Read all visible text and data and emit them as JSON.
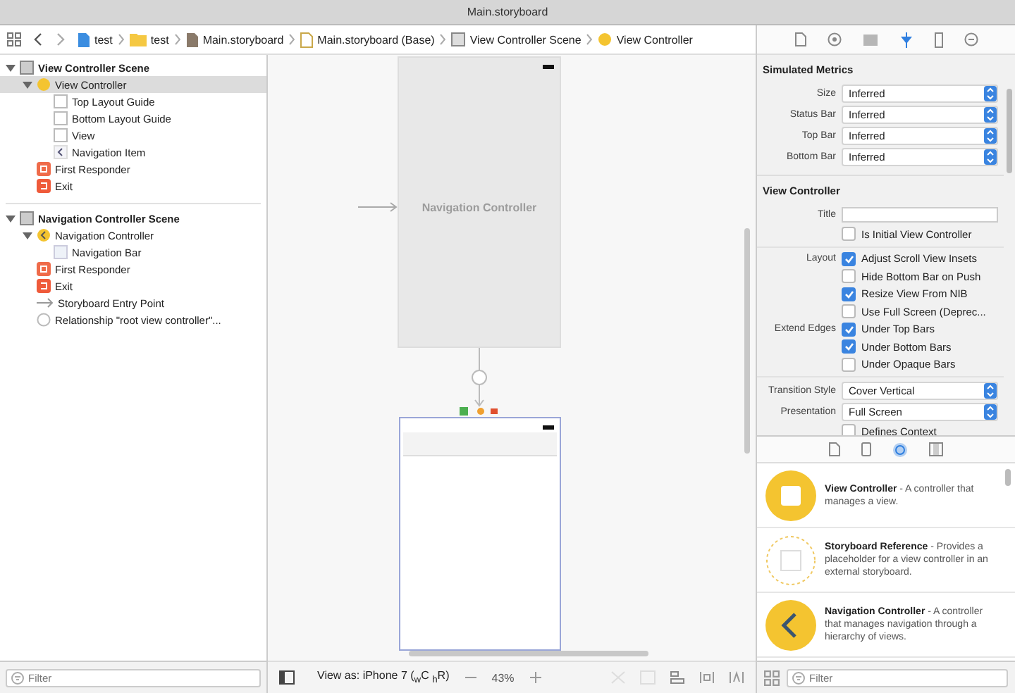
{
  "window": {
    "title": "Main.storyboard"
  },
  "breadcrumbs": [
    {
      "label": "test",
      "kind": "project"
    },
    {
      "label": "test",
      "kind": "folder"
    },
    {
      "label": "Main.storyboard",
      "kind": "storyboard"
    },
    {
      "label": "Main.storyboard (Base)",
      "kind": "localized"
    },
    {
      "label": "View Controller Scene",
      "kind": "scene"
    },
    {
      "label": "View Controller",
      "kind": "controller"
    }
  ],
  "outline": {
    "items": [
      {
        "label": "View Controller Scene",
        "kind": "scene",
        "expanded": true,
        "selected": false,
        "children": [
          {
            "label": "View Controller",
            "kind": "controller",
            "expanded": true,
            "selected": true,
            "children": [
              {
                "label": "Top Layout Guide",
                "kind": "guide",
                "selected": false
              },
              {
                "label": "Bottom Layout Guide",
                "kind": "guide",
                "selected": false
              },
              {
                "label": "View",
                "kind": "view",
                "selected": false
              },
              {
                "label": "Navigation Item",
                "kind": "navitem",
                "selected": false
              }
            ]
          },
          {
            "label": "First Responder",
            "kind": "responder",
            "selected": false
          },
          {
            "label": "Exit",
            "kind": "exit",
            "selected": false
          }
        ]
      },
      {
        "label": "Navigation Controller Scene",
        "kind": "scene",
        "expanded": true,
        "selected": false,
        "children": [
          {
            "label": "Navigation Controller",
            "kind": "navcontroller",
            "expanded": true,
            "selected": false,
            "children": [
              {
                "label": "Navigation Bar",
                "kind": "navbar",
                "selected": false
              }
            ]
          },
          {
            "label": "First Responder",
            "kind": "responder",
            "selected": false
          },
          {
            "label": "Exit",
            "kind": "exit",
            "selected": false
          },
          {
            "label": "Storyboard Entry Point",
            "kind": "entry",
            "selected": false
          },
          {
            "label": "Relationship \"root view controller\"...",
            "kind": "relationship",
            "selected": false
          }
        ]
      }
    ],
    "filter": {
      "placeholder": "Filter"
    }
  },
  "canvas": {
    "scene_title": "Navigation Controller",
    "view_as": "View as: iPhone 7 ($_{w}$C $_{h}$R)",
    "zoom": "43%"
  },
  "inspector": {
    "tabs": [
      {
        "kind": "file",
        "selected": false
      },
      {
        "kind": "help",
        "selected": false
      },
      {
        "kind": "identity",
        "selected": false
      },
      {
        "kind": "attributes",
        "selected": true
      },
      {
        "kind": "size",
        "selected": false
      },
      {
        "kind": "connections",
        "selected": false
      }
    ],
    "simulated_metrics": {
      "title": "Simulated Metrics",
      "fields": [
        {
          "label": "Size",
          "value": "Inferred"
        },
        {
          "label": "Status Bar",
          "value": "Inferred"
        },
        {
          "label": "Top Bar",
          "value": "Inferred"
        },
        {
          "label": "Bottom Bar",
          "value": "Inferred"
        }
      ]
    },
    "view_controller": {
      "title": "View Controller",
      "title_label": "Title",
      "rows": [
        {
          "kind": "checkbox",
          "text": "Is Initial View Controller",
          "checked": false
        },
        {
          "kind": "checkbox",
          "label": "Layout",
          "text": "Adjust Scroll View Insets",
          "checked": true
        },
        {
          "kind": "checkbox",
          "text": "Hide Bottom Bar on Push",
          "checked": false
        },
        {
          "kind": "checkbox",
          "text": "Resize View From NIB",
          "checked": true
        },
        {
          "kind": "checkbox",
          "text": "Use Full Screen (Deprec...",
          "checked": false
        },
        {
          "kind": "checkbox",
          "label": "Extend Edges",
          "text": "Under Top Bars",
          "checked": true
        },
        {
          "kind": "checkbox",
          "text": "Under Bottom Bars",
          "checked": true
        },
        {
          "kind": "checkbox",
          "text": "Under Opaque Bars",
          "checked": false
        },
        {
          "kind": "popup",
          "label": "Transition Style",
          "text": "Cover Vertical"
        },
        {
          "kind": "popup",
          "label": "Presentation",
          "text": "Full Screen"
        },
        {
          "kind": "checkbox",
          "text": "Defines Context",
          "checked": false
        }
      ]
    }
  },
  "library": {
    "tabs": [
      {
        "kind": "file",
        "selected": false
      },
      {
        "kind": "code",
        "selected": false
      },
      {
        "kind": "object",
        "selected": true
      },
      {
        "kind": "media",
        "selected": false
      }
    ],
    "items": [
      {
        "kind": "controller",
        "title": "View Controller",
        "description": " - A controller that manages a view."
      },
      {
        "kind": "reference",
        "title": "Storyboard Reference",
        "description": " - Provides a placeholder for a view controller in an external storyboard."
      },
      {
        "kind": "navigation",
        "title": "Navigation Controller",
        "description": " - A controller that manages navigation through a hierarchy of views."
      }
    ],
    "filter": {
      "placeholder": "Filter"
    }
  }
}
